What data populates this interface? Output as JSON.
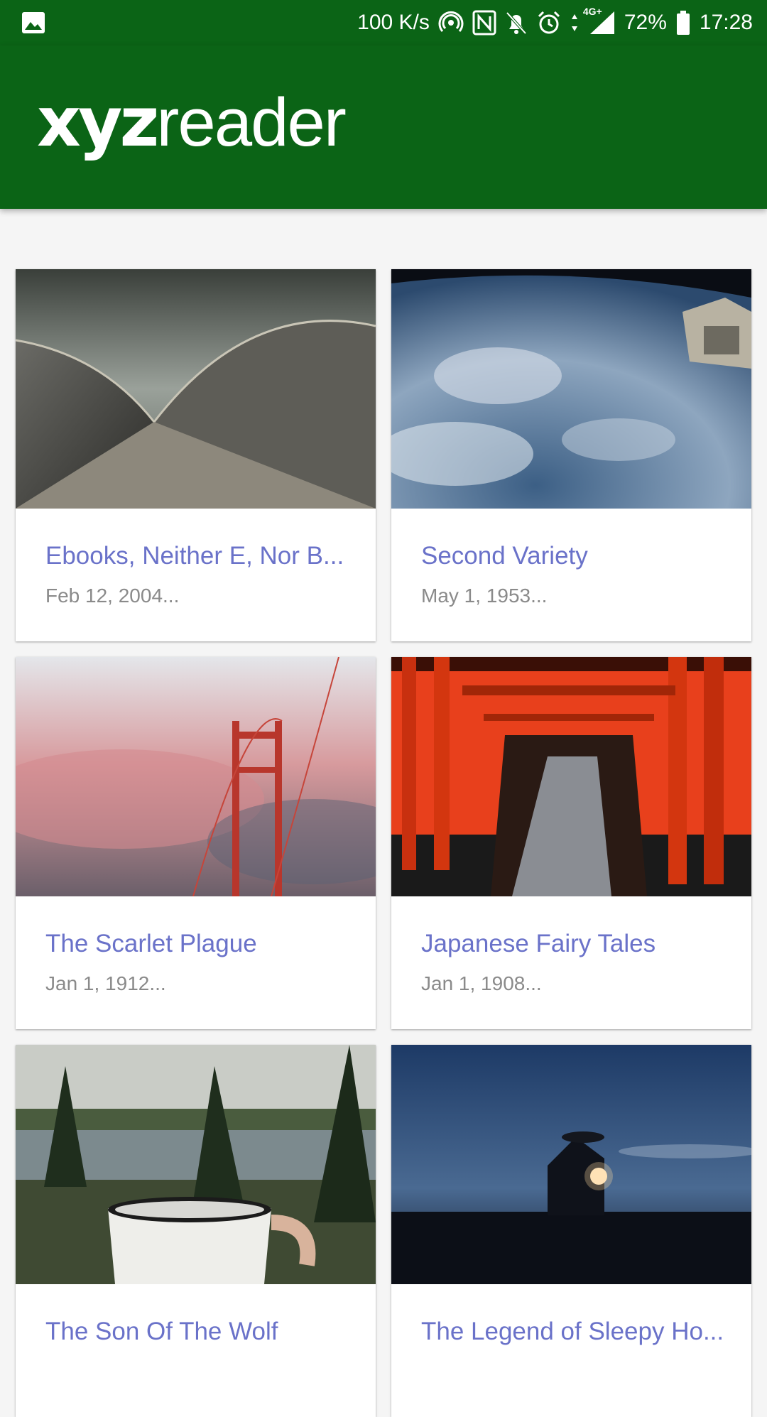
{
  "status_bar": {
    "speed": "100 K/s",
    "network": "4G+",
    "battery": "72%",
    "time": "17:28"
  },
  "app": {
    "logo_bold": "xyz",
    "logo_light": "reader",
    "accent": "#0b6416",
    "title_color": "#6a72c9"
  },
  "articles": [
    {
      "title": "Ebooks, Neither E, Nor B...",
      "date": "Feb 12, 2004..."
    },
    {
      "title": "Second Variety",
      "date": "May 1, 1953..."
    },
    {
      "title": "The Scarlet Plague",
      "date": "Jan 1, 1912..."
    },
    {
      "title": "Japanese Fairy Tales",
      "date": "Jan 1, 1908..."
    },
    {
      "title": "The Son Of The Wolf",
      "date": ""
    },
    {
      "title": "The Legend of Sleepy Ho...",
      "date": ""
    }
  ]
}
